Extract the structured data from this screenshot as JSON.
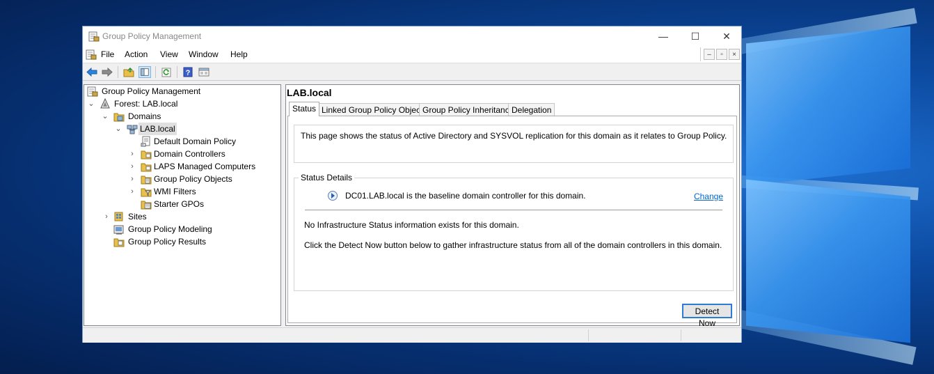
{
  "window": {
    "title": "Group Policy Management",
    "controls": {
      "minimize": "—",
      "maximize": "☐",
      "close": "✕"
    }
  },
  "menu": {
    "items": [
      "File",
      "Action",
      "Window",
      "Help"
    ],
    "view_label": "View",
    "mdi": {
      "minimize": "–",
      "restore": "▫",
      "close": "×"
    }
  },
  "toolbar": {
    "buttons": [
      "back-icon",
      "forward-icon",
      "up-folder-icon",
      "show-hide-tree-icon",
      "refresh-icon",
      "help-icon",
      "properties-icon"
    ]
  },
  "tree": {
    "root": "Group Policy Management",
    "forest": "Forest: LAB.local",
    "domains": "Domains",
    "domain": "LAB.local",
    "children": [
      "Default Domain Policy",
      "Domain Controllers",
      "LAPS Managed Computers",
      "Group Policy Objects",
      "WMI Filters",
      "Starter GPOs"
    ],
    "sites": "Sites",
    "modeling": "Group Policy Modeling",
    "results": "Group Policy Results"
  },
  "details": {
    "title": "LAB.local",
    "tabs": [
      "Status",
      "Linked Group Policy Objects",
      "Group Policy Inheritance",
      "Delegation"
    ],
    "active_tab": "Status",
    "info_text": "This page shows the status of Active Directory and SYSVOL replication for this domain as it relates to Group Policy.",
    "status_details_label": "Status Details",
    "baseline_text": "DC01.LAB.local is the baseline domain controller for this domain.",
    "change_link": "Change",
    "no_info_text": "No Infrastructure Status information exists for this domain.",
    "instruction_text": "Click the Detect Now button below to gather infrastructure status from all of the domain controllers in this domain.",
    "detect_button": "Detect Now"
  },
  "colors": {
    "accent": "#2b7cd3",
    "link": "#0066cc",
    "desktop": "#0c4aa0"
  }
}
